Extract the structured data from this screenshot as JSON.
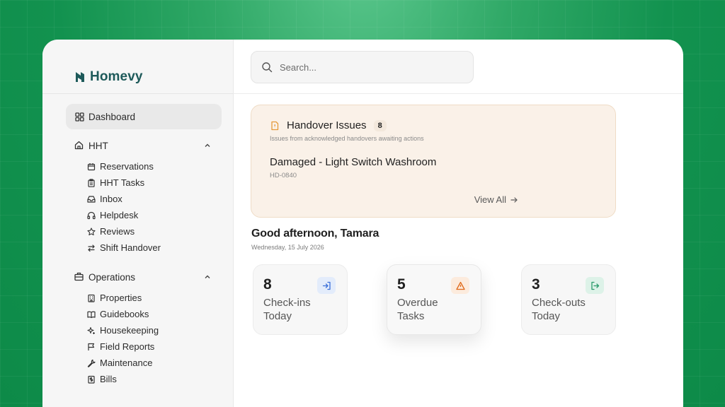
{
  "brand": {
    "name": "Homevy",
    "color": "#1e5a5a"
  },
  "sidebar": {
    "dashboard": {
      "label": "Dashboard",
      "icon": "dashboard-icon"
    },
    "sections": [
      {
        "label": "HHT",
        "icon": "home-icon",
        "items": [
          {
            "label": "Reservations",
            "icon": "calendar-icon"
          },
          {
            "label": "HHT Tasks",
            "icon": "clipboard-icon"
          },
          {
            "label": "Inbox",
            "icon": "inbox-icon"
          },
          {
            "label": "Helpdesk",
            "icon": "headphones-icon"
          },
          {
            "label": "Reviews",
            "icon": "star-icon"
          },
          {
            "label": "Shift Handover",
            "icon": "swap-icon"
          }
        ]
      },
      {
        "label": "Operations",
        "icon": "briefcase-icon",
        "items": [
          {
            "label": "Properties",
            "icon": "building-icon"
          },
          {
            "label": "Guidebooks",
            "icon": "book-icon"
          },
          {
            "label": "Housekeeping",
            "icon": "sparkle-icon"
          },
          {
            "label": "Field Reports",
            "icon": "flag-icon"
          },
          {
            "label": "Maintenance",
            "icon": "wrench-icon"
          },
          {
            "label": "Bills",
            "icon": "receipt-icon"
          }
        ]
      }
    ]
  },
  "search": {
    "placeholder": "Search..."
  },
  "handover": {
    "title": "Handover Issues",
    "count": "8",
    "subtitle": "Issues from acknowledged handovers awaiting actions",
    "issue_title": "Damaged - Light Switch Washroom",
    "issue_code": "HD-0840",
    "view_all": "View All",
    "accent": "#e59a3a"
  },
  "greeting": {
    "title": "Good afternoon, Tamara",
    "date": "Wednesday, 15 July 2026"
  },
  "stats": [
    {
      "value": "8",
      "label": "Check-ins Today",
      "icon": "log-in-icon",
      "icon_color": "#3b6fd8",
      "icon_bg": "#e3ecfb"
    },
    {
      "value": "5",
      "label": "Overdue Tasks",
      "icon": "warning-icon",
      "icon_color": "#e06a1a",
      "icon_bg": "#fcebdd"
    },
    {
      "value": "3",
      "label": "Check-outs Today",
      "icon": "log-out-icon",
      "icon_color": "#2a9a6a",
      "icon_bg": "#ddf2e8"
    }
  ]
}
